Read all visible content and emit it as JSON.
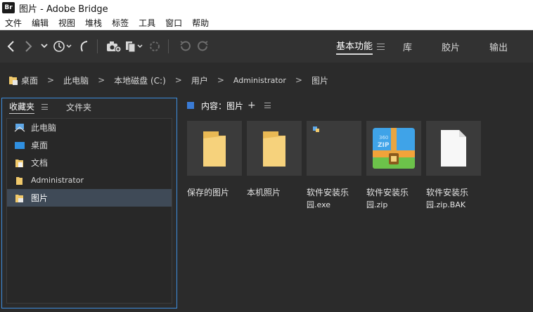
{
  "window": {
    "app_logo": "Br",
    "title": "图片 - Adobe Bridge"
  },
  "menubar": {
    "items": [
      "文件",
      "编辑",
      "视图",
      "堆栈",
      "标签",
      "工具",
      "窗口",
      "帮助"
    ]
  },
  "toolbar": {
    "icons": [
      "back-icon",
      "forward-icon",
      "chevron-down-icon",
      "history-icon",
      "boomerang-icon",
      "camera-icon",
      "copy-icon",
      "refine-icon",
      "rotate-left-icon",
      "rotate-right-icon"
    ]
  },
  "workspaces": {
    "items": [
      "基本功能",
      "库",
      "胶片",
      "输出"
    ],
    "active": "基本功能"
  },
  "breadcrumb": {
    "items": [
      "桌面",
      "此电脑",
      "本地磁盘 (C:)",
      "用户",
      "Administrator",
      "图片"
    ]
  },
  "left_panel": {
    "tabs": [
      "收藏夹",
      "文件夹"
    ],
    "favorites": [
      {
        "label": "此电脑",
        "icon": "computer-icon"
      },
      {
        "label": "桌面",
        "icon": "desktop-icon"
      },
      {
        "label": "文档",
        "icon": "document-folder-icon"
      },
      {
        "label": "Administrator",
        "icon": "user-folder-icon"
      },
      {
        "label": "图片",
        "icon": "pictures-folder-icon"
      }
    ],
    "selected": "图片"
  },
  "content": {
    "header_label": "内容：图片",
    "plus": "+",
    "items": [
      {
        "line1": "保存的图片",
        "line2": "",
        "type": "folder"
      },
      {
        "line1": "本机照片",
        "line2": "",
        "type": "folder"
      },
      {
        "line1": "软件安装乐",
        "line2": "园.exe",
        "type": "exe"
      },
      {
        "line1": "软件安装乐",
        "line2": "园.zip",
        "type": "zip"
      },
      {
        "line1": "软件安装乐",
        "line2": "园.zip.BAK",
        "type": "blank"
      }
    ],
    "zip_text": "ZIP",
    "zip_brand": "360"
  },
  "colors": {
    "accent": "#3e8ede",
    "folder": "#f0c96b",
    "selected_row": "#3f4a57"
  }
}
